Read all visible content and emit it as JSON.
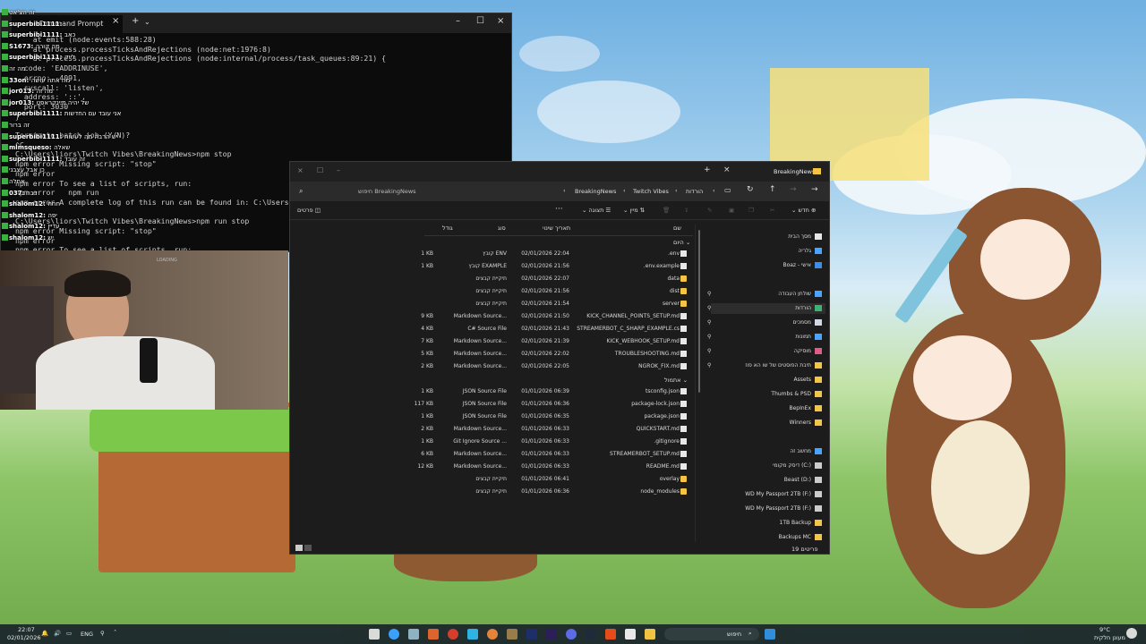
{
  "terminal": {
    "tab_title": "Command Prompt",
    "lines": [
      "    at emit (node:events:588:28)",
      "    at process.processTicksAndRejections (node:net:1976:8)",
      "    at process.processTicksAndRejections (node:internal/process/task_queues:89:21) {",
      "  code: 'EADDRINUSE',",
      "  errno: -4091,",
      "  syscall: 'listen',",
      "  address: '::',",
      "  port: 3030",
      "}",
      "",
      "Terminate batch job (Y/N)?",
      "^C",
      "C:\\Users\\liors\\Twitch Vibes\\BreakingNews>npm stop",
      "npm error Missing script: \"stop\"",
      "npm error",
      "npm error To see a list of scripts, run:",
      "npm error   npm run",
      "npm error A complete log of this run can be found in: C:\\Users\\liors",
      "",
      "C:\\Users\\liors\\Twitch Vibes\\BreakingNews>npm run stop",
      "npm error Missing script: \"stop\"",
      "npm error",
      "npm error To see a list of scripts, run:"
    ]
  },
  "chat": [
    {
      "user": "",
      "msg": "זה הצ'אט"
    },
    {
      "user": "superbibi1111",
      "msg": ""
    },
    {
      "user": "superbibi1111",
      "msg": "כאב"
    },
    {
      "user": "S1673",
      "msg": "מה קורה"
    },
    {
      "user": "superbibi1111",
      "msg": "לייק"
    },
    {
      "user": "",
      "msg": "מה זה"
    },
    {
      "user": "33on",
      "msg": "מה אתה עושה"
    },
    {
      "user": "jor013",
      "msg": "מה זה"
    },
    {
      "user": "jor013",
      "msg": "של יהיה מיינקראפט"
    },
    {
      "user": "superbibi1111",
      "msg": "אני עובד עם החדשות"
    },
    {
      "user": "",
      "msg": "זה ברור"
    },
    {
      "user": "superbibi1111",
      "msg": "יש הרבה מה לעשות"
    },
    {
      "user": "mlmsqueso",
      "msg": "שאלה"
    },
    {
      "user": "superbibi1111",
      "msg": "זה עובד"
    },
    {
      "user": "",
      "msg": "כן אבל עצבני"
    },
    {
      "user": "",
      "msg": "אחלה"
    },
    {
      "user": "037",
      "msg": "דבר"
    },
    {
      "user": "shalom12",
      "msg": "חחח"
    },
    {
      "user": "shalom12",
      "msg": "יפה"
    },
    {
      "user": "shalom12",
      "msg": "עדיין"
    },
    {
      "user": "shalom12",
      "msg": "יש"
    }
  ],
  "explorer": {
    "breadcrumb": [
      "הורדות",
      "Twitch Vibes",
      "BreakingNews"
    ],
    "window_title": "BreakingNews",
    "search_placeholder": "חיפוש BreakingNews",
    "toolbar": {
      "new": "חדש",
      "sort": "מיין",
      "view": "תצוגה",
      "details": "פרטים"
    },
    "columns": {
      "name": "שם",
      "modified": "תאריך שינוי",
      "type": "סוג",
      "size": "גודל"
    },
    "group_today": "היום",
    "group_yesterday": "אתמול",
    "today_rows": [
      {
        "name": ".env",
        "date": "02/01/2026 22:04",
        "type": "קובץ ENV",
        "size": "1 KB",
        "kind": "file"
      },
      {
        "name": ".env.example",
        "date": "02/01/2026 21:56",
        "type": "קובץ EXAMPLE",
        "size": "1 KB",
        "kind": "file"
      },
      {
        "name": "data",
        "date": "02/01/2026 22:07",
        "type": "תיקיית קבצים",
        "size": "",
        "kind": "folder"
      },
      {
        "name": "dist",
        "date": "02/01/2026 21:56",
        "type": "תיקיית קבצים",
        "size": "",
        "kind": "folder"
      },
      {
        "name": "server",
        "date": "02/01/2026 21:54",
        "type": "תיקיית קבצים",
        "size": "",
        "kind": "folder"
      },
      {
        "name": "KICK_CHANNEL_POINTS_SETUP.md",
        "date": "02/01/2026 21:50",
        "type": "Markdown Source...",
        "size": "9 KB",
        "kind": "file"
      },
      {
        "name": "STREAMERBOT_C_SHARP_EXAMPLE.cs",
        "date": "02/01/2026 21:43",
        "type": "C# Source File",
        "size": "4 KB",
        "kind": "file"
      },
      {
        "name": "KICK_WEBHOOK_SETUP.md",
        "date": "02/01/2026 21:39",
        "type": "Markdown Source...",
        "size": "7 KB",
        "kind": "file"
      },
      {
        "name": "TROUBLESHOOTING.md",
        "date": "02/01/2026 22:02",
        "type": "Markdown Source...",
        "size": "5 KB",
        "kind": "file"
      },
      {
        "name": "NGROK_FIX.md",
        "date": "02/01/2026 22:05",
        "type": "Markdown Source...",
        "size": "2 KB",
        "kind": "file"
      }
    ],
    "yesterday_rows": [
      {
        "name": "tsconfig.json",
        "date": "01/01/2026 06:39",
        "type": "JSON Source File",
        "size": "1 KB",
        "kind": "file"
      },
      {
        "name": "package-lock.json",
        "date": "01/01/2026 06:36",
        "type": "JSON Source File",
        "size": "117 KB",
        "kind": "file"
      },
      {
        "name": "package.json",
        "date": "01/01/2026 06:35",
        "type": "JSON Source File",
        "size": "1 KB",
        "kind": "file"
      },
      {
        "name": "QUICKSTART.md",
        "date": "01/01/2026 06:33",
        "type": "Markdown Source...",
        "size": "2 KB",
        "kind": "file"
      },
      {
        "name": ".gitignore",
        "date": "01/01/2026 06:33",
        "type": "Git Ignore Source ...",
        "size": "1 KB",
        "kind": "file"
      },
      {
        "name": "STREAMERBOT_SETUP.md",
        "date": "01/01/2026 06:33",
        "type": "Markdown Source...",
        "size": "6 KB",
        "kind": "file"
      },
      {
        "name": "README.md",
        "date": "01/01/2026 06:33",
        "type": "Markdown Source...",
        "size": "12 KB",
        "kind": "file"
      },
      {
        "name": "overlay",
        "date": "01/01/2026 06:41",
        "type": "תיקיית קבצים",
        "size": "",
        "kind": "folder"
      },
      {
        "name": "node_modules",
        "date": "01/01/2026 06:36",
        "type": "תיקיית קבצים",
        "size": "",
        "kind": "folder"
      }
    ],
    "sidebar": [
      {
        "label": "מסך הבית",
        "icon": "home-icon",
        "color": "#e6e6e6"
      },
      {
        "label": "גלריה",
        "icon": "gallery-icon",
        "color": "#4aa3ff"
      },
      {
        "label": "Boaz - אישי",
        "icon": "cloud-icon",
        "color": "#3b8ee8"
      },
      {
        "label": "שולחן העבודה",
        "icon": "desktop-icon",
        "color": "#4aa3ff"
      },
      {
        "label": "הורדות",
        "icon": "download-icon",
        "color": "#3cb371"
      },
      {
        "label": "מסמכים",
        "icon": "document-icon",
        "color": "#cfd8e6"
      },
      {
        "label": "תמונות",
        "icon": "pictures-icon",
        "color": "#4aa3ff"
      },
      {
        "label": "מוסיקה",
        "icon": "music-icon",
        "color": "#e05a8a"
      },
      {
        "label": "תיבת הפוסטים של שו הא פוז",
        "icon": "folder-icon",
        "color": "#f4c542"
      },
      {
        "label": "Assets",
        "icon": "folder-icon",
        "color": "#f4c542"
      },
      {
        "label": "Thumbs & PSD",
        "icon": "folder-icon",
        "color": "#f4c542"
      },
      {
        "label": "BepInEx",
        "icon": "folder-icon",
        "color": "#f4c542"
      },
      {
        "label": "Winners",
        "icon": "folder-icon",
        "color": "#f4c542"
      },
      {
        "label": "מחשב זה",
        "icon": "computer-icon",
        "color": "#4aa3ff"
      },
      {
        "label": "דיסק מקומי (C:)",
        "icon": "drive-icon",
        "color": "#cccccc"
      },
      {
        "label": "Beast (D:)",
        "icon": "drive-icon",
        "color": "#cccccc"
      },
      {
        "label": "WD My Passport 2TB (F:)",
        "icon": "drive-icon",
        "color": "#cccccc"
      },
      {
        "label": "WD My Passport 2TB (F:)",
        "icon": "drive-icon",
        "color": "#cccccc"
      },
      {
        "label": "1TB Backup",
        "icon": "folder-icon",
        "color": "#f4c542"
      },
      {
        "label": "Backups MC",
        "icon": "folder-icon",
        "color": "#f4c542"
      }
    ],
    "status": "19 פריטים"
  },
  "taskbar": {
    "time": "22:07",
    "date": "02/01/2026",
    "lang": "ENG",
    "search": "חיפוש",
    "weather_temp": "9°C",
    "weather_desc": "מעונן חלקית",
    "accent": "#1e2a2e"
  },
  "webcam": {
    "label": "LOADING"
  }
}
